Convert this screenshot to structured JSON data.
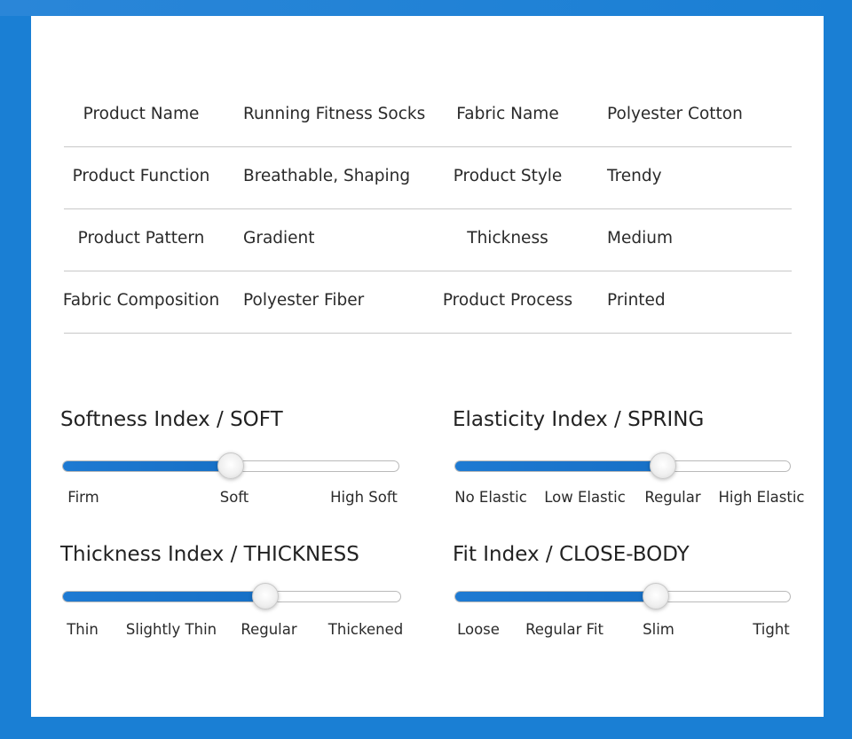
{
  "specs": [
    {
      "label1": "Product Name",
      "value1": "Running Fitness Socks",
      "label2": "Fabric Name",
      "value2": "Polyester Cotton"
    },
    {
      "label1": "Product Function",
      "value1": "Breathable, Shaping",
      "label2": "Product Style",
      "value2": "Trendy"
    },
    {
      "label1": "Product Pattern",
      "value1": "Gradient",
      "label2": "Thickness",
      "value2": "Medium"
    },
    {
      "label1": "Fabric Composition",
      "value1": "Polyester Fiber",
      "label2": "Product Process",
      "value2": "Printed"
    }
  ],
  "sliders": {
    "softness": {
      "title": "Softness Index / SOFT",
      "ticks": [
        "Firm",
        "Soft",
        "High Soft"
      ],
      "level": 0.5
    },
    "elasticity": {
      "title": "Elasticity Index / SPRING",
      "ticks": [
        "No Elastic",
        "Low Elastic",
        "Regular",
        "High Elastic"
      ],
      "level": 0.62
    },
    "thickness": {
      "title": "Thickness Index / THICKNESS",
      "ticks": [
        "Thin",
        "Slightly Thin",
        "Regular",
        "Thickened"
      ],
      "level": 0.6
    },
    "fit": {
      "title": "Fit Index / CLOSE-BODY",
      "ticks": [
        "Loose",
        "Regular Fit",
        "Slim",
        "Tight"
      ],
      "level": 0.6
    }
  },
  "colors": {
    "accent": "#1a7fd4",
    "track_fill": "#1e7ad2"
  }
}
